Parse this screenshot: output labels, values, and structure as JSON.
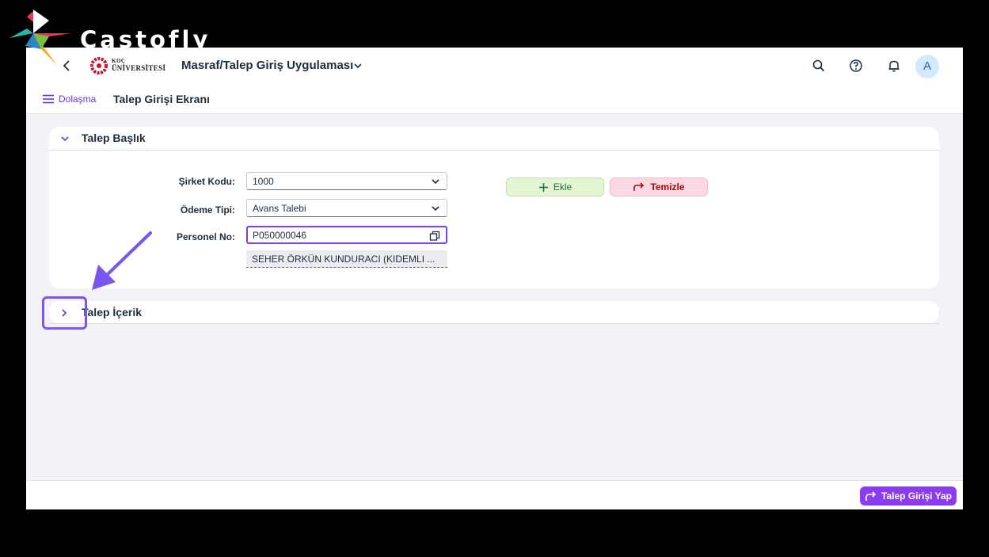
{
  "watermark": {
    "text": "Castofly"
  },
  "shellbar": {
    "logo_line1": "KOÇ",
    "logo_line2": "ÜNİVERSİTESİ",
    "app_title": "Masraf/Talep Giriş Uygulaması",
    "avatar_initial": "A"
  },
  "subheader": {
    "nav_label": "Dolaşma",
    "page_title": "Talep Girişi Ekranı"
  },
  "header_panel": {
    "title": "Talep Başlık",
    "expanded": true,
    "fields": {
      "company_code_label": "Şirket Kodu:",
      "company_code_value": "1000",
      "payment_type_label": "Ödeme Tipi:",
      "payment_type_value": "Avans Talebi",
      "personnel_no_label": "Personel No:",
      "personnel_no_value": "P050000046",
      "personnel_name": "SEHER ÖRKÜN KUNDURACI (KIDEMLI ..."
    },
    "buttons": {
      "add": "Ekle",
      "clear": "Temizle"
    }
  },
  "content_panel": {
    "title": "Talep İçerik",
    "expanded": false
  },
  "footer": {
    "submit": "Talep Girişi Yap"
  },
  "colors": {
    "accent": "#7d3cf0",
    "add_bg": "#e4f5d4",
    "clear_bg": "#fbd9e3",
    "submit_bg": "#8a3df0"
  }
}
